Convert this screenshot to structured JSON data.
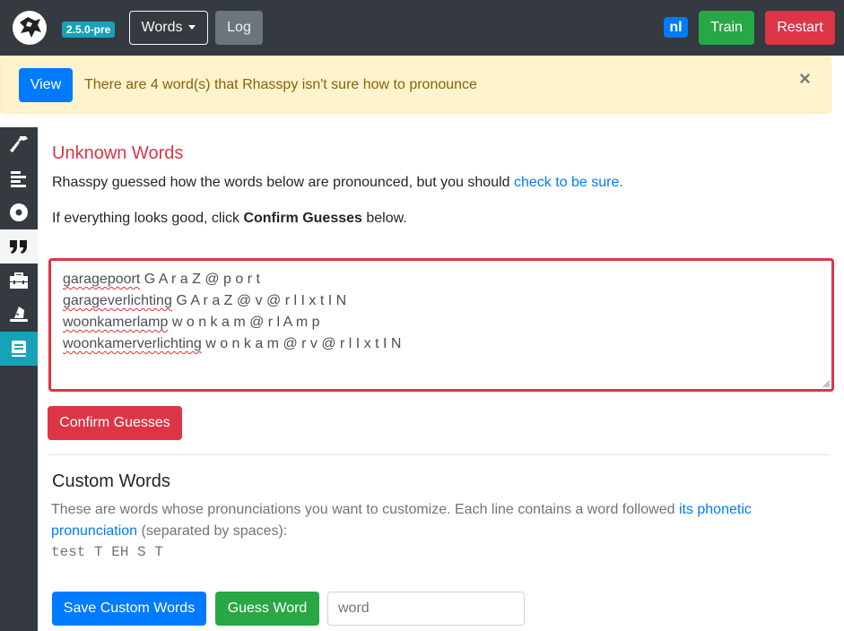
{
  "navbar": {
    "version": "2.5.0-pre",
    "words_label": "Words",
    "log_label": "Log",
    "language": "nl",
    "train_label": "Train",
    "restart_label": "Restart"
  },
  "alert": {
    "view_label": "View",
    "message": "There are 4 word(s) that Rhasspy isn't sure how to pronounce",
    "close_symbol": "×"
  },
  "sidebar": {
    "items": [
      {
        "icon": "hammer-icon"
      },
      {
        "icon": "align-left-icon"
      },
      {
        "icon": "record-icon"
      },
      {
        "icon": "quote-icon",
        "active": true
      },
      {
        "icon": "toolbox-icon"
      },
      {
        "icon": "wizard-hat-icon"
      },
      {
        "icon": "book-icon",
        "selected": true
      }
    ]
  },
  "unknown": {
    "title": "Unknown Words",
    "desc_prefix": "Rhasspy guessed how the words below are pronounced, but you should ",
    "desc_link": "check to be sure.",
    "confirm_prefix": "If everything looks good, click ",
    "confirm_bold": "Confirm Guesses",
    "confirm_suffix": " below.",
    "guesses": [
      {
        "word": "garagepoort",
        "phonemes": "G A r a Z @ p o r t"
      },
      {
        "word": "garageverlichting",
        "phonemes": "G A r a Z @ v @ r l I x t I N"
      },
      {
        "word": "woonkamerlamp",
        "phonemes": "w o n k a m @ r l A m p"
      },
      {
        "word": "woonkamerverlichting",
        "phonemes": "w o n k a m @ r v @ r l I x t I N"
      }
    ],
    "confirm_button": "Confirm Guesses"
  },
  "custom": {
    "title": "Custom Words",
    "desc_prefix": "These are words whose pronunciations you want to customize. Each line contains a word followed ",
    "desc_link": "its phonetic pronunciation",
    "desc_suffix": " (separated by spaces):",
    "example": "test T EH S T",
    "save_button": "Save Custom Words",
    "guess_button": "Guess Word",
    "word_placeholder": "word"
  },
  "colors": {
    "navbar": "#343a40",
    "danger": "#dc3545",
    "success": "#28a745",
    "primary": "#007bff",
    "info": "#17a2b8",
    "warning_bg": "#fff3cd"
  }
}
